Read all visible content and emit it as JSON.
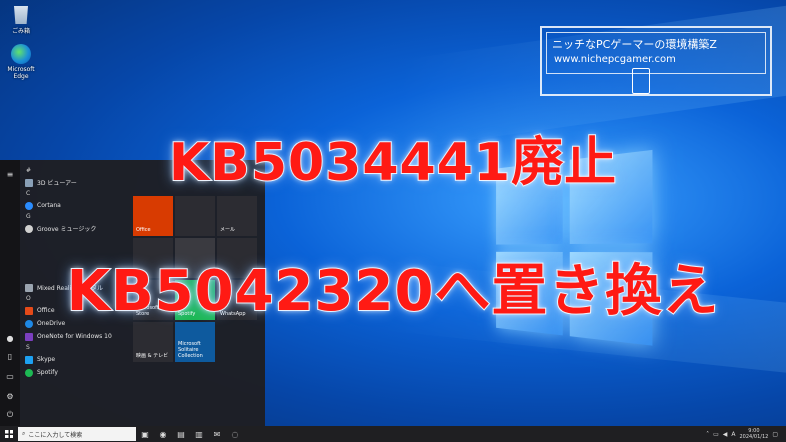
{
  "desktop": {
    "icons": [
      {
        "label": "ごみ箱",
        "icon": "recycle-bin-icon"
      },
      {
        "label": "Microsoft Edge",
        "icon": "edge-icon"
      }
    ]
  },
  "headline": {
    "line1": "KB5034441廃止",
    "line2": "KB5042320へ置き換え"
  },
  "watermark": {
    "title": "ニッチなPCゲーマーの環境構築Z",
    "url": "www.nichepcgamer.com"
  },
  "start_menu": {
    "sections": [
      {
        "letter": "#",
        "apps": [
          {
            "label": "3D ビューアー",
            "color": "#8aa0b8"
          }
        ]
      },
      {
        "letter": "C",
        "apps": [
          {
            "label": "Cortana",
            "color": "#2a8cff"
          }
        ]
      },
      {
        "letter": "G",
        "apps": [
          {
            "label": "Groove ミュージック",
            "color": "#d0d0d0"
          }
        ]
      },
      {
        "letter": "",
        "apps": [
          {
            "label": "Mixed Reality ポータル",
            "color": "#9aa4b0"
          }
        ]
      },
      {
        "letter": "O",
        "apps": [
          {
            "label": "Office",
            "color": "#e64a19"
          },
          {
            "label": "OneDrive",
            "color": "#1e88e5"
          },
          {
            "label": "OneNote for Windows 10",
            "color": "#7b3fbf"
          }
        ]
      },
      {
        "letter": "S",
        "apps": [
          {
            "label": "Skype",
            "color": "#1da1f2"
          },
          {
            "label": "Spotify",
            "color": "#1db954"
          }
        ]
      }
    ],
    "tiles": [
      {
        "label": "Office",
        "color": "#d83b01"
      },
      {
        "label": "",
        "color": "#2c2c32"
      },
      {
        "label": "メール",
        "color": "#2c2c32"
      },
      {
        "label": "",
        "color": "#2c2c32"
      },
      {
        "label": "",
        "color": "#3a3a40"
      },
      {
        "label": "",
        "color": "#2c2c32"
      },
      {
        "label": "Microsoft Store",
        "color": "#2c2c32"
      },
      {
        "label": "Spotify",
        "color": "#1db954"
      },
      {
        "label": "WhatsApp",
        "color": "#2c2c32"
      },
      {
        "label": "映画 & テレビ",
        "color": "#2c2c32"
      },
      {
        "label": "Microsoft Solitaire Collection",
        "color": "#0e5a9e"
      }
    ]
  },
  "taskbar": {
    "search_placeholder": "ここに入力して検索",
    "tray": {
      "ime": "A",
      "time": "9:00",
      "date": "2024/01/12"
    }
  }
}
